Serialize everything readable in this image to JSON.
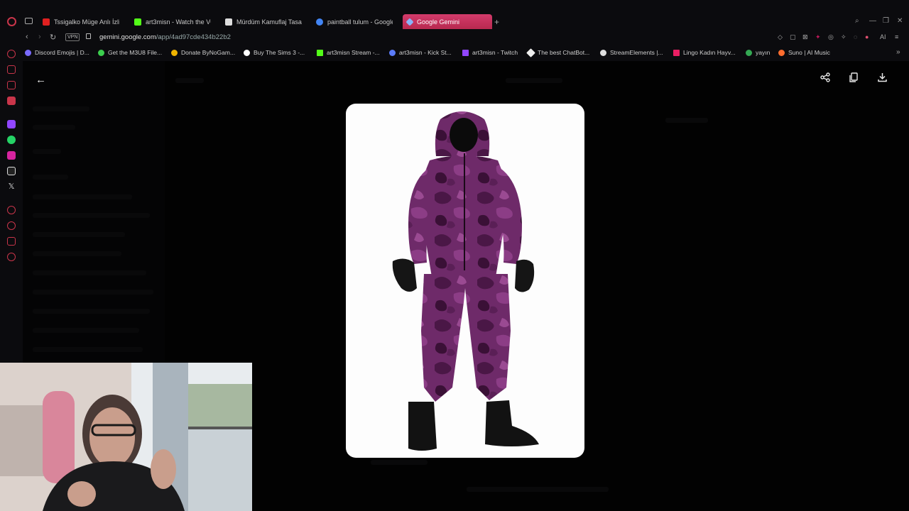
{
  "browser": {
    "tabs": [
      {
        "label": "Tssigalko Müge Anlı İzliyor",
        "favicon_color": "#e02020",
        "active": false
      },
      {
        "label": "art3misn - Watch the VOD",
        "favicon_color": "#53fc18",
        "active": false
      },
      {
        "label": "Mürdüm Kamuflaj Tasarımı",
        "favicon_color": "#dddddd",
        "active": false
      },
      {
        "label": "paintball tulum - Google'da",
        "favicon_color": "#4285f4",
        "active": false
      },
      {
        "label": "Google Gemini",
        "favicon_color": "#8ab4f8",
        "active": true
      }
    ],
    "new_tab_glyph": "+",
    "vpn_label": "VPN",
    "url_host": "gemini.google.com",
    "url_path": "/app/4ad97cde434b22b2",
    "ai_label": "AI",
    "bookmarks": [
      {
        "label": "Discord Emojis | D...",
        "color": "#7a6bff"
      },
      {
        "label": "Get the M3U8 File...",
        "color": "#3ccf4e"
      },
      {
        "label": "Donate ByNoGam...",
        "color": "#f0b400"
      },
      {
        "label": "Buy The Sims 3 -...",
        "color": "#ffffff"
      },
      {
        "label": "art3misn Stream -...",
        "color": "#53fc18"
      },
      {
        "label": "art3misn - Kick St...",
        "color": "#5b7cfa"
      },
      {
        "label": "art3misn - Twitch",
        "color": "#9146ff"
      },
      {
        "label": "The best ChatBot...",
        "color": "#eeeeee"
      },
      {
        "label": "StreamElements |...",
        "color": "#dddddd"
      },
      {
        "label": "Lingo Kadın Hayv...",
        "color": "#e91e63"
      },
      {
        "label": "yayın",
        "color": "#34a853"
      },
      {
        "label": "Suno | AI Music",
        "color": "#ff6d2e"
      }
    ]
  },
  "viewer": {
    "back_icon": "arrow-left-icon",
    "actions": [
      "share-icon",
      "copy-icon",
      "download-icon"
    ],
    "image_subject": "purple camouflage paintball coverall with black hood, gloves and boots"
  }
}
